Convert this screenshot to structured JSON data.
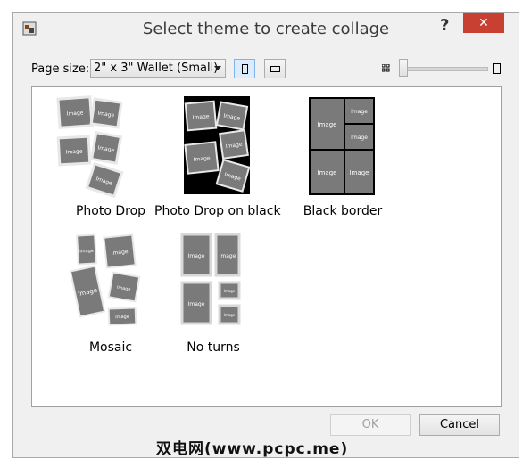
{
  "window": {
    "title": "Select theme to create collage",
    "help_label": "?",
    "close_label": "✕"
  },
  "toolbar": {
    "page_size_label": "Page size:",
    "page_size_value": "2\" x 3\" Wallet (Small)",
    "orientation_selected": "portrait",
    "size_slider_value": 0
  },
  "themes": [
    {
      "label": "Photo Drop"
    },
    {
      "label": "Photo Drop on black"
    },
    {
      "label": "Black border"
    },
    {
      "label": "Mosaic"
    },
    {
      "label": "No turns"
    }
  ],
  "placeholder_text": "Image",
  "buttons": {
    "ok_label": "OK",
    "cancel_label": "Cancel"
  },
  "watermark": "双电网(www.pcpc.me)",
  "colors": {
    "close_red": "#c84031",
    "image_gray": "#7a7a7a",
    "black_bg": "#000000"
  }
}
